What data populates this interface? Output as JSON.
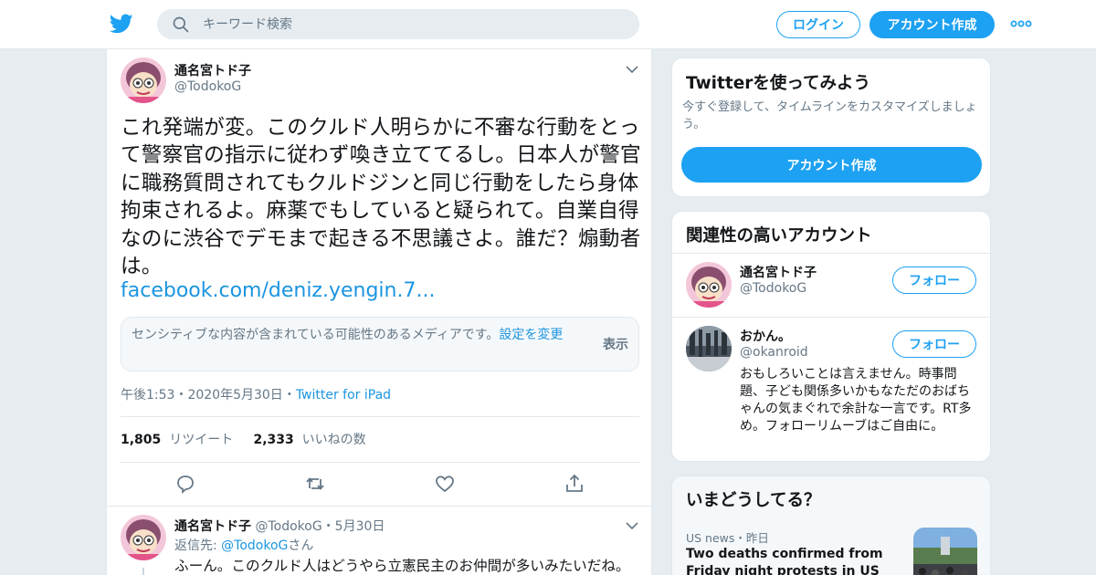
{
  "header": {
    "search_placeholder": "キーワード検索",
    "login_label": "ログイン",
    "signup_label": "アカウント作成",
    "brand_color": "#1da1f2"
  },
  "tweet": {
    "author_name": "通名宮トド子",
    "author_handle": "@TodokoG",
    "text": "これ発端が変。このクルド人明らかに不審な行動をとって警察官の指示に従わず喚き立ててるし。日本人が警官に職務質問されてもクルドジンと同じ行動をしたら身体拘束されるよ。麻薬でもしていると疑られて。自業自得なのに渋谷でデモまで起きる不思議さよ。誰だ？煽動者は。",
    "link": "facebook.com/deniz.yengin.7...",
    "sensitive_text": "センシティブな内容が含まれている可能性のあるメディアです。",
    "sensitive_link": "設定を変更",
    "show_label": "表示",
    "time": "午後1:53",
    "date": "2020年5月30日",
    "source": "Twitter for iPad",
    "retweet_count": "1,805",
    "retweet_label": "リツイート",
    "like_count": "2,333",
    "like_label": "いいねの数"
  },
  "reply": {
    "author_name": "通名宮トド子",
    "author_handle": "@TodokoG",
    "date": "5月30日",
    "replying_to_label": "返信先: ",
    "replying_to_handle": "@TodokoG",
    "replying_to_suffix": "さん",
    "text": "ふーん。このクルド人はどうやら立憲民主のお仲間が多いみたいだね。プロ市民の仲間で警察に喧嘩を売る口実を探して…"
  },
  "sidebar": {
    "signup_card": {
      "title": "Twitterを使ってみよう",
      "description": "今すぐ登録して、タイムラインをカスタマイズしましょう。",
      "button": "アカウント作成"
    },
    "related": {
      "title": "関連性の高いアカウント",
      "follow_label": "フォロー",
      "accounts": [
        {
          "name": "通名宮トド子",
          "handle": "@TodokoG",
          "bio": ""
        },
        {
          "name": "おかん。",
          "handle": "@okanroid",
          "bio": "おもしろいことは言えません。時事問題、子ども関係多いかもなただのおばちゃんの気まぐれで余計な一言です。RT多め。フォローリムーブはご自由に。"
        }
      ]
    },
    "trends": {
      "title": "いまどうしてる？",
      "items": [
        {
          "meta": "US news・昨日",
          "title": "Two deaths confirmed from Friday night protests in US cities"
        }
      ]
    }
  }
}
